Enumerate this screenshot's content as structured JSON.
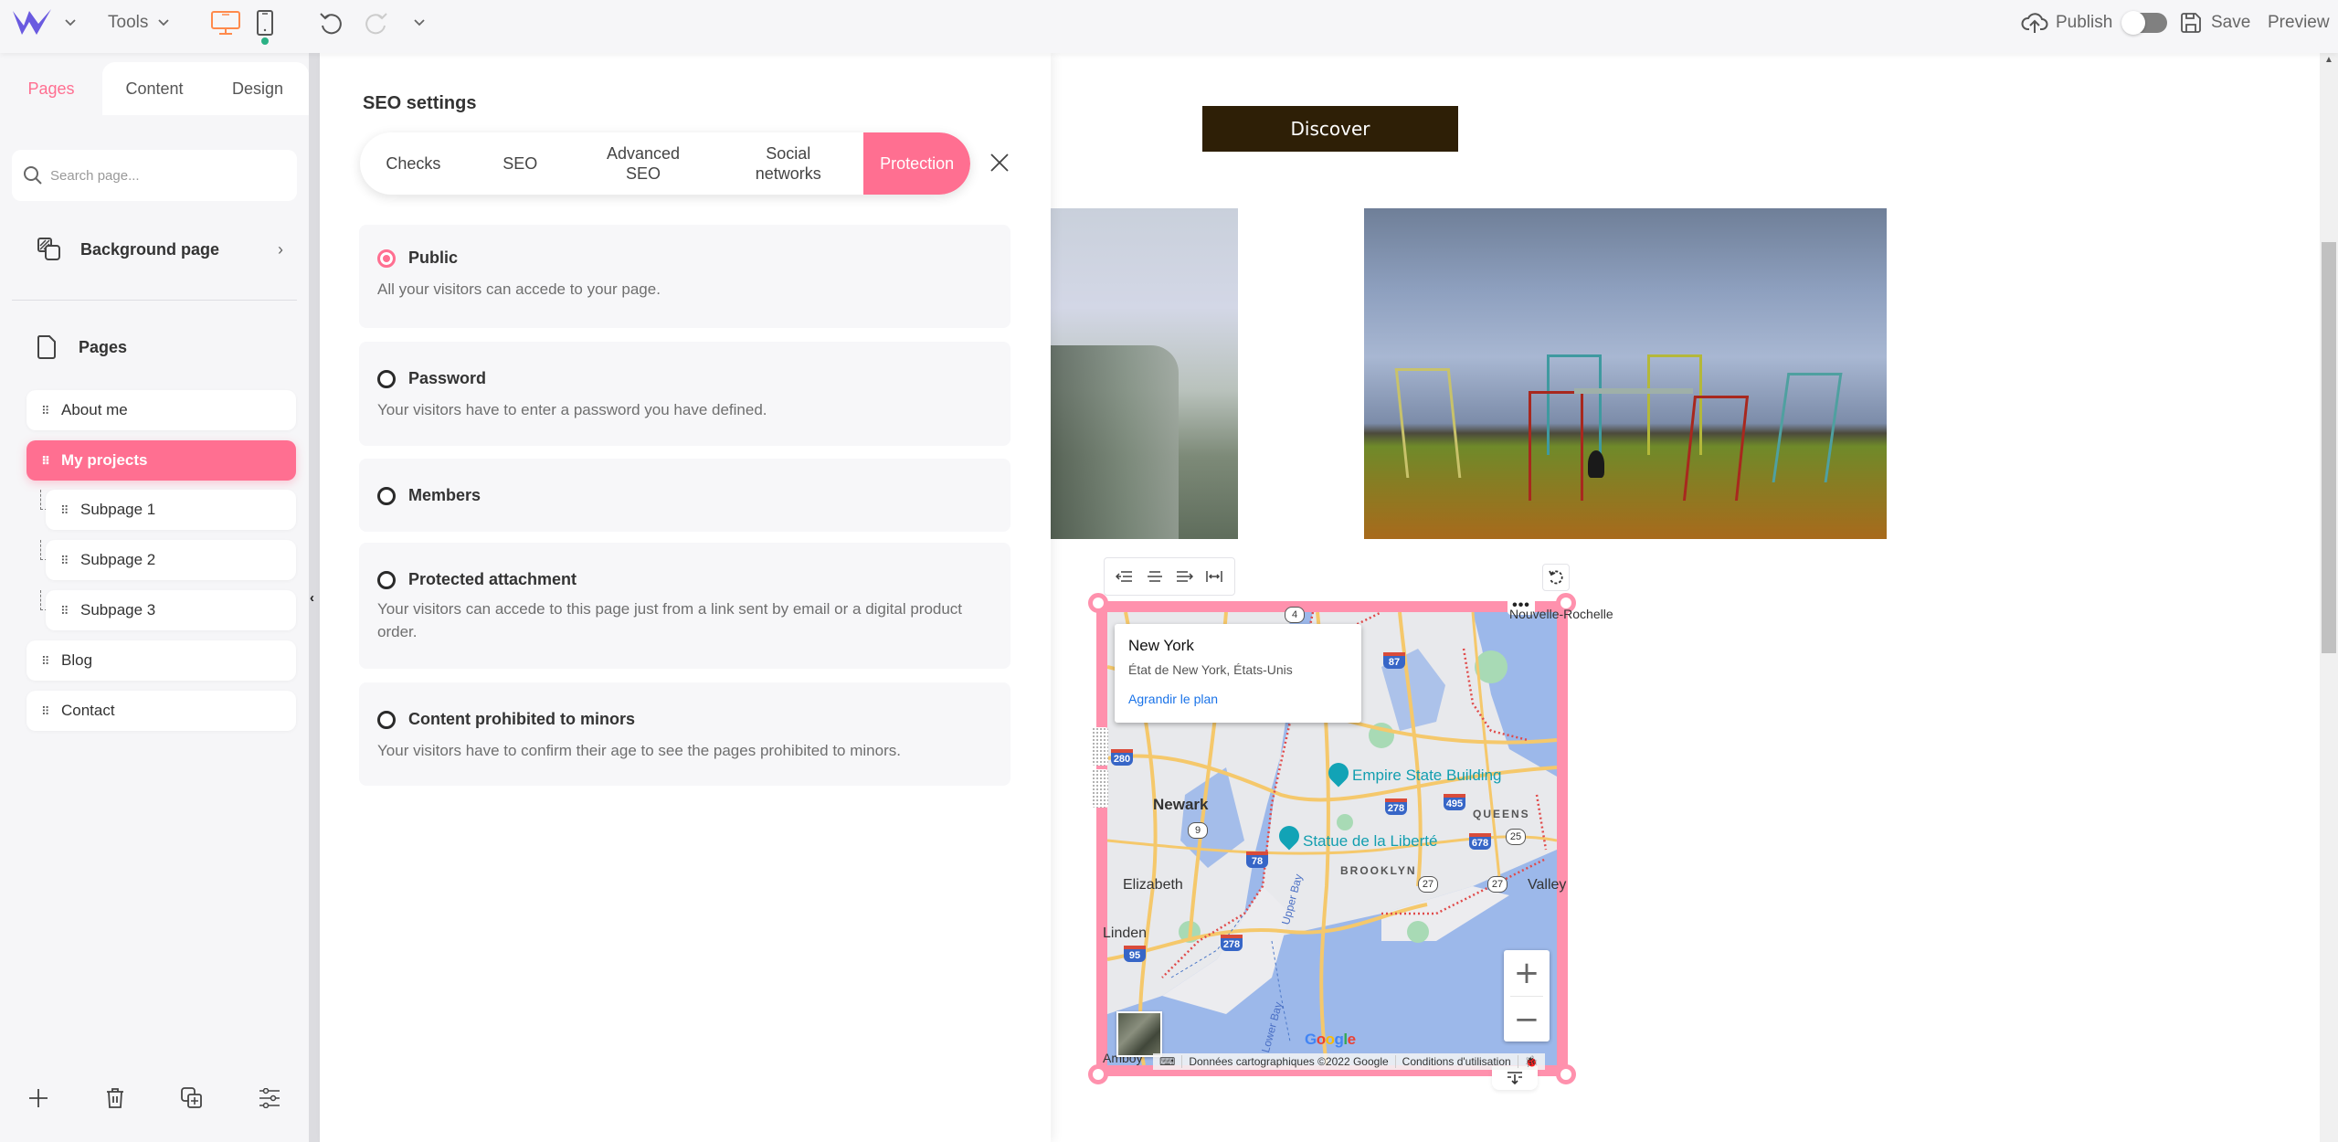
{
  "topbar": {
    "tools_label": "Tools",
    "publish_label": "Publish",
    "publish_toggle_on": false,
    "save_label": "Save",
    "preview_label": "Preview",
    "active_device": "desktop",
    "colors": {
      "brand": "#6a5ae0",
      "active_device": "#ff8a4c",
      "mobile_dot": "#2bb185"
    }
  },
  "sidebar": {
    "tabs": [
      {
        "label": "Pages",
        "active": true
      },
      {
        "label": "Content",
        "active": false
      },
      {
        "label": "Design",
        "active": false
      }
    ],
    "search_placeholder": "Search page...",
    "background_page_label": "Background page",
    "pages_heading": "Pages",
    "pages": [
      {
        "label": "About me",
        "level": 0,
        "active": false
      },
      {
        "label": "My projects",
        "level": 0,
        "active": true
      },
      {
        "label": "Subpage 1",
        "level": 1,
        "active": false
      },
      {
        "label": "Subpage 2",
        "level": 1,
        "active": false
      },
      {
        "label": "Subpage 3",
        "level": 1,
        "active": false
      },
      {
        "label": "Blog",
        "level": 0,
        "active": false
      },
      {
        "label": "Contact",
        "level": 0,
        "active": false
      }
    ],
    "bottom_actions": [
      "add-icon",
      "trash-icon",
      "duplicate-icon",
      "settings-sliders-icon"
    ],
    "accent": "#ff6f91"
  },
  "seo_panel": {
    "title": "SEO settings",
    "tabs": [
      {
        "label": "Checks",
        "active": false
      },
      {
        "label": "SEO",
        "active": false
      },
      {
        "label": "Advanced SEO",
        "active": false
      },
      {
        "label": "Social networks",
        "active": false
      },
      {
        "label": "Protection",
        "active": true
      }
    ],
    "options": [
      {
        "label": "Public",
        "description": "All your visitors can accede to your page.",
        "selected": true
      },
      {
        "label": "Password",
        "description": "Your visitors have to enter a password you have defined.",
        "selected": false
      },
      {
        "label": "Members",
        "description": "",
        "selected": false
      },
      {
        "label": "Protected attachment",
        "description": "Your visitors can accede to this page just from a link sent by email or a digital product order.",
        "selected": false
      },
      {
        "label": "Content prohibited to minors",
        "description": "Your visitors have to confirm their age to see the pages prohibited to minors.",
        "selected": false
      }
    ]
  },
  "canvas": {
    "discover_button": "Discover",
    "map": {
      "info_title": "New York",
      "info_subtitle": "État de New York, États-Unis",
      "info_link": "Agrandir le plan",
      "labels": {
        "newark": "Newark",
        "empire": "Empire State Building",
        "statue": "Statue de la Liberté",
        "queens": "QUEENS",
        "brooklyn": "BROOKLYN",
        "elizabeth": "Elizabeth",
        "linden": "Linden",
        "valley": "Valley",
        "upper_bay": "Upper Bay",
        "lower_bay": "Lower Bay",
        "nouvelle": "Nouvelle-Rochelle",
        "amboy": "Amboy"
      },
      "shields": {
        "i87": "87",
        "i280": "280",
        "i278a": "278",
        "i495": "495",
        "i678": "678",
        "i78": "78",
        "i95": "95",
        "i278b": "278"
      },
      "routes": {
        "r4": "4",
        "r9": "9",
        "r25": "25",
        "r27a": "27",
        "r27b": "27"
      },
      "google_logo": "Google",
      "attribution": "Données cartographiques ©2022 Google",
      "terms": "Conditions d'utilisation",
      "zoom_in": "+",
      "zoom_out": "−",
      "selection_color": "#ff91ad"
    }
  }
}
